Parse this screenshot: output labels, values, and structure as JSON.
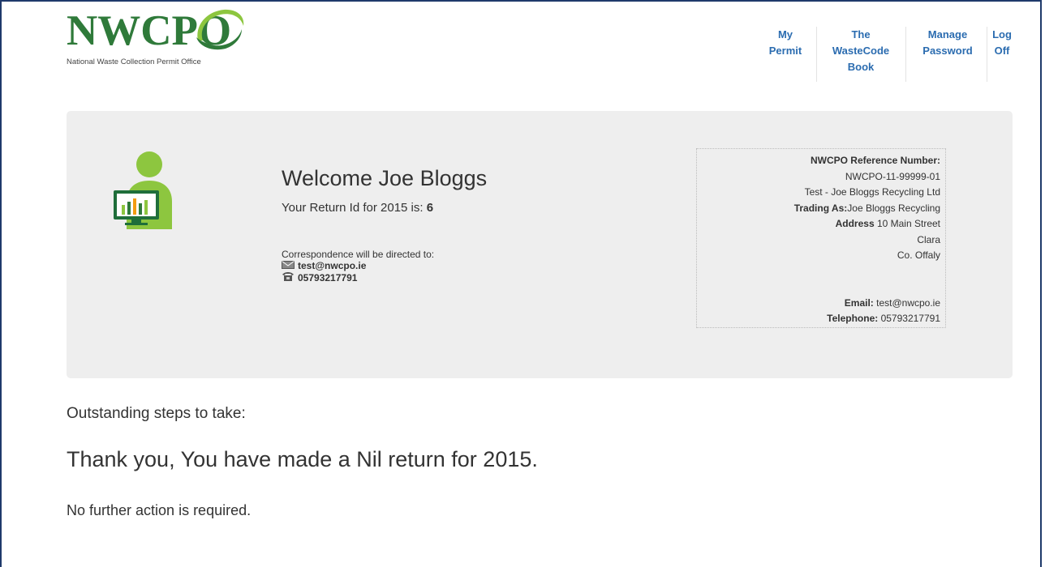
{
  "logo": {
    "wordmark": "NWCPO",
    "subtitle": "National Waste Collection Permit Office",
    "brand_color": "#2f7a3a",
    "accent_color": "#8dc63f"
  },
  "nav": {
    "items": [
      {
        "line1": "My",
        "line2": "Permit",
        "line3": ""
      },
      {
        "line1": "The",
        "line2": "WasteCode",
        "line3": "Book"
      },
      {
        "line1": "Manage",
        "line2": "Password",
        "line3": ""
      },
      {
        "line1": "Log",
        "line2": "Off",
        "line3": ""
      }
    ],
    "link_color": "#2b6cb0"
  },
  "welcome": {
    "avatar_icon": "user-with-monitor-chart-icon",
    "title": "Welcome Joe Bloggs",
    "return_prefix": "Your Return Id for 2015 is: ",
    "return_id": "6",
    "correspondence_label": "Correspondence will be directed to:",
    "email_icon": "envelope-icon",
    "email": "test@nwcpo.ie",
    "phone_icon": "telephone-icon",
    "phone": "05793217791"
  },
  "reference": {
    "ref_label": "NWCPO Reference Number:",
    "ref_number": "NWCPO-11-99999-01",
    "company": "Test - Joe Bloggs Recycling Ltd",
    "trading_label": "Trading As:",
    "trading_value": "Joe Bloggs Recycling",
    "address_label": "Address",
    "address_line1": " 10 Main Street",
    "address_line2": "Clara",
    "address_line3": "Co. Offaly",
    "email_label": "Email:",
    "email_value": " test@nwcpo.ie",
    "phone_label": "Telephone:",
    "phone_value": " 05793217791"
  },
  "main": {
    "steps_heading": "Outstanding steps to take:",
    "thanks_message": "Thank you, You have made a Nil return for 2015.",
    "no_action": "No further action is required."
  }
}
